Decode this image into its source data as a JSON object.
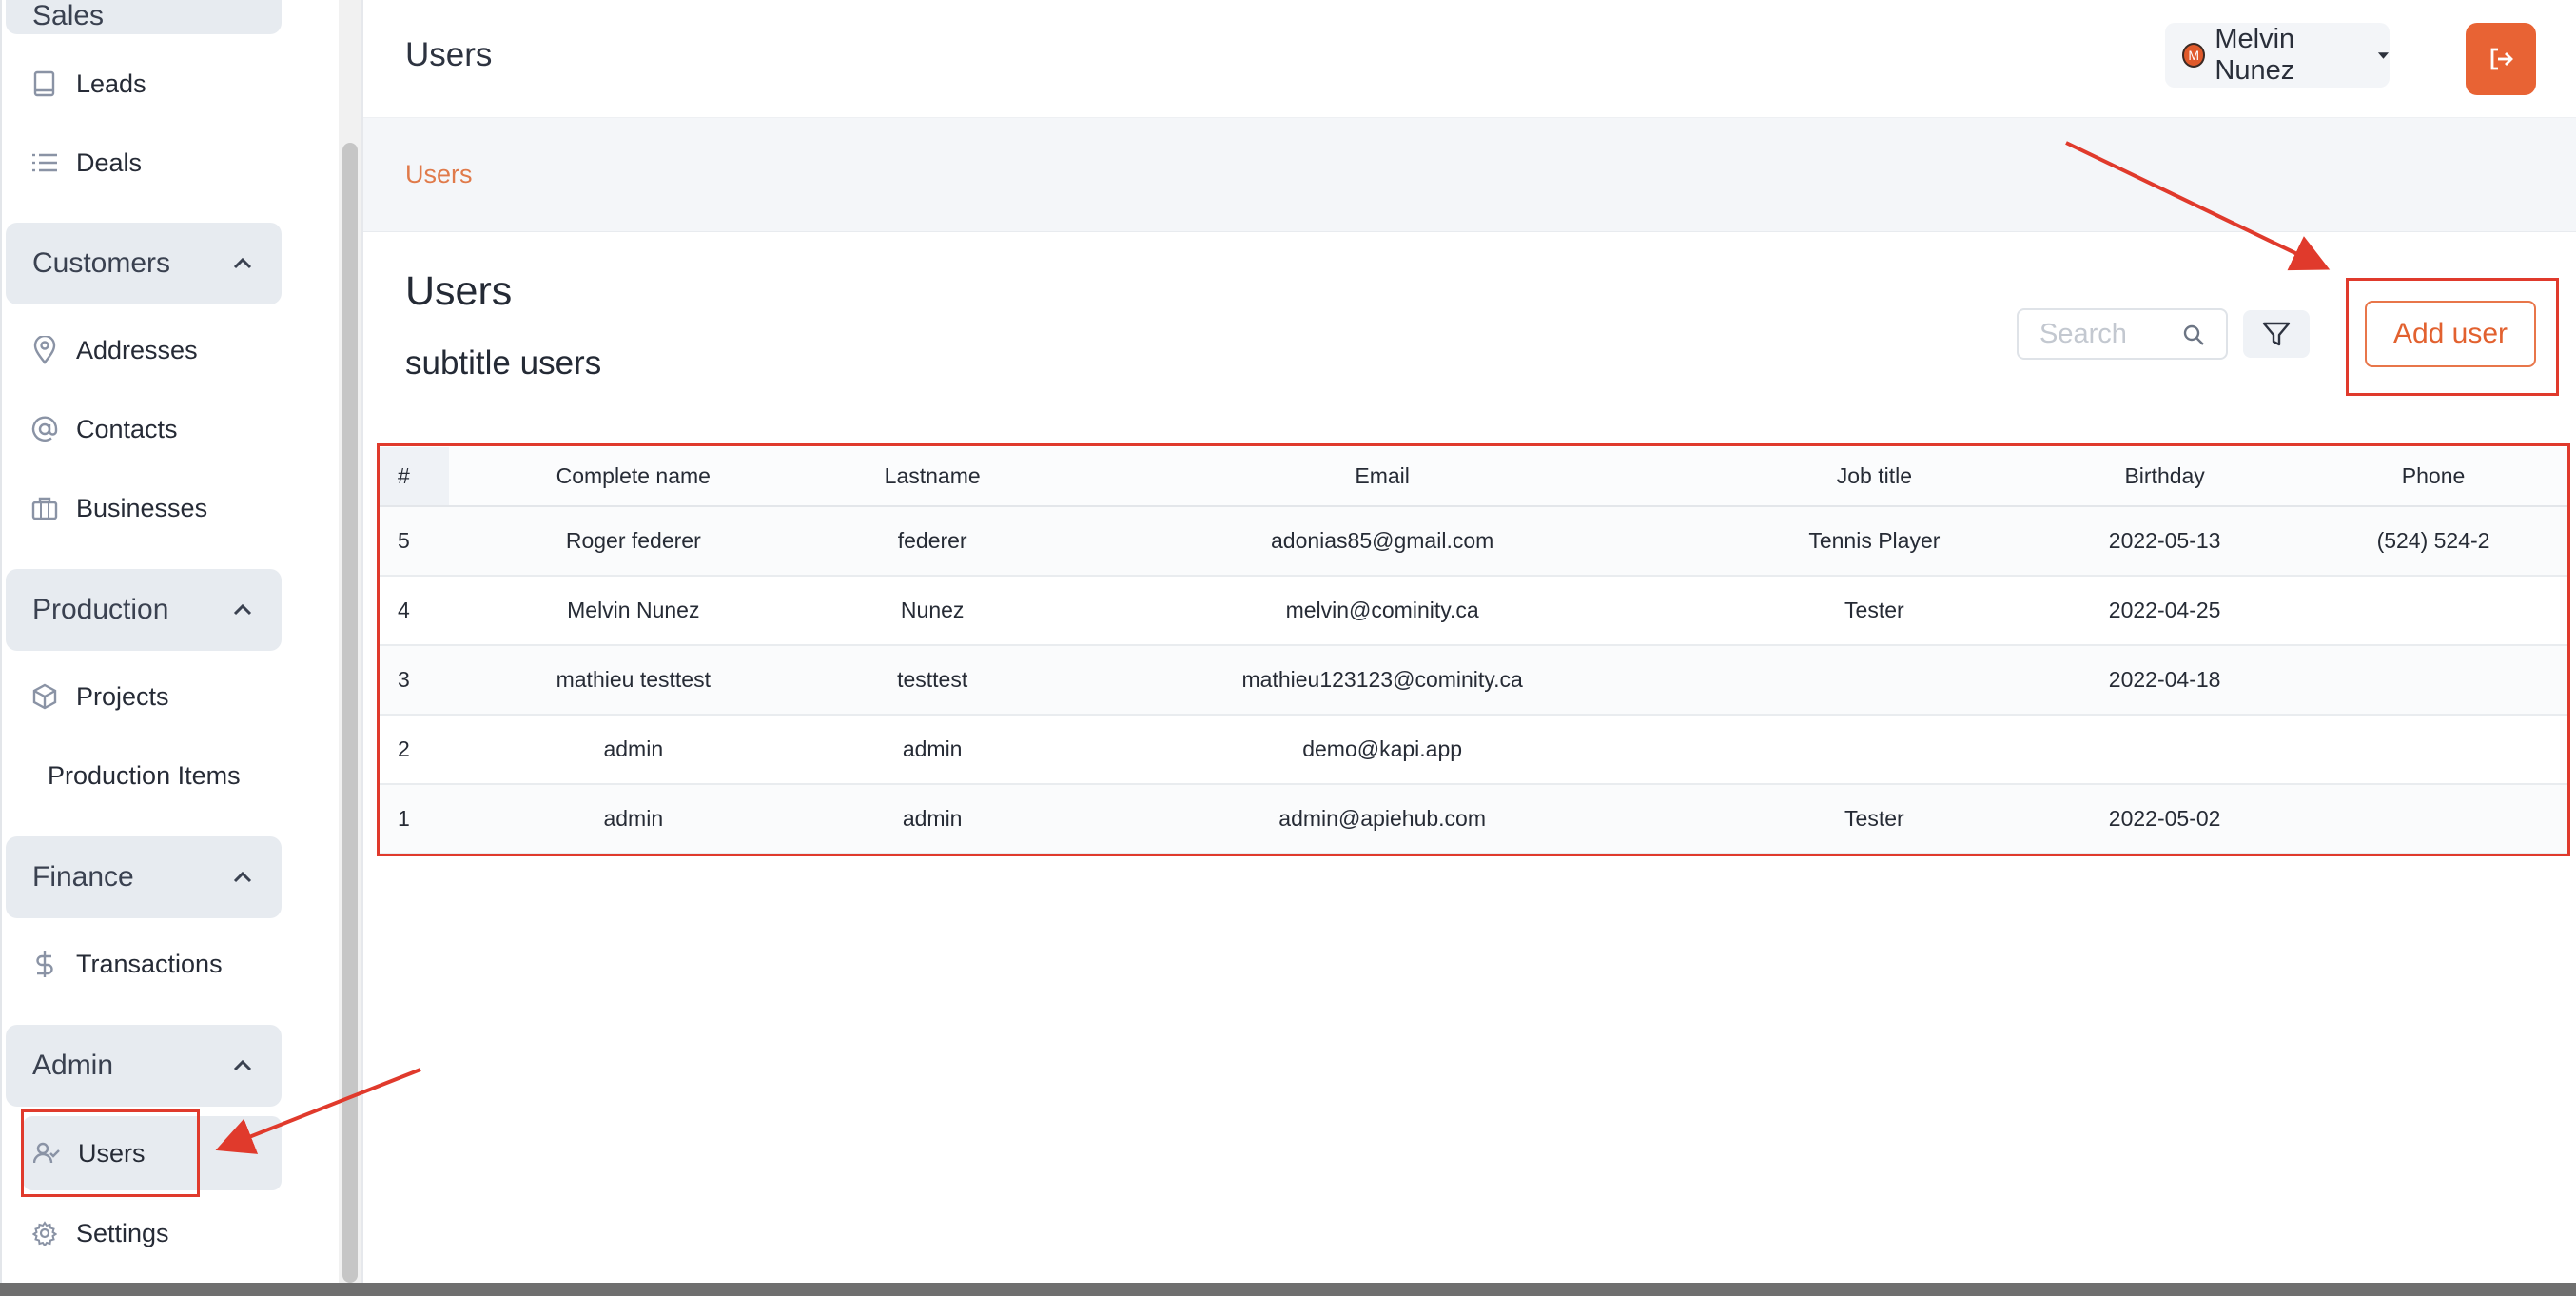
{
  "sidebar": {
    "top_partial": "Sales",
    "groups": [
      {
        "label": "Customers"
      },
      {
        "label": "Production"
      },
      {
        "label": "Finance"
      },
      {
        "label": "Admin"
      }
    ],
    "items": {
      "leads": "Leads",
      "deals": "Deals",
      "addresses": "Addresses",
      "contacts": "Contacts",
      "businesses": "Businesses",
      "projects": "Projects",
      "production_items": "Production Items",
      "transactions": "Transactions",
      "users": "Users",
      "settings": "Settings"
    }
  },
  "header": {
    "title": "Users",
    "user_name": "Melvin Nunez",
    "avatar_letter": "M"
  },
  "breadcrumb": {
    "current": "Users"
  },
  "page": {
    "title": "Users",
    "subtitle": "subtitle users",
    "search_placeholder": "Search",
    "add_label": "Add user"
  },
  "table": {
    "columns": [
      "#",
      "Complete name",
      "Lastname",
      "Email",
      "Job title",
      "Birthday",
      "Phone"
    ],
    "rows": [
      [
        "5",
        "Roger federer",
        "federer",
        "adonias85@gmail.com",
        "Tennis Player",
        "2022-05-13",
        "(524) 524-2"
      ],
      [
        "4",
        "Melvin Nunez",
        "Nunez",
        "melvin@cominity.ca",
        "Tester",
        "2022-04-25",
        ""
      ],
      [
        "3",
        "mathieu testtest",
        "testtest",
        "mathieu123123@cominity.ca",
        "",
        "2022-04-18",
        ""
      ],
      [
        "2",
        "admin",
        "admin",
        "demo@kapi.app",
        "",
        "",
        ""
      ],
      [
        "1",
        "admin",
        "admin",
        "admin@apiehub.com",
        "Tester",
        "2022-05-02",
        ""
      ]
    ]
  },
  "colors": {
    "accent": "#e86334",
    "annotation": "#e03a2c",
    "breadcrumb": "#e07a4a"
  }
}
